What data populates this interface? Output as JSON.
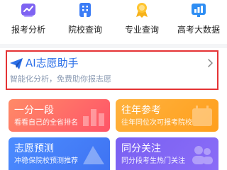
{
  "colors": {
    "assistant_border": "#e53335",
    "assistant_title": "#2b6fe8",
    "card_1": "#ff6a68",
    "card_2": "#ffa92f",
    "card_3": "#4680f8",
    "card_4": "#8066f4"
  },
  "nav": [
    {
      "label": "报考分析",
      "icon": "chart-analysis-icon"
    },
    {
      "label": "院校查询",
      "icon": "building-icon"
    },
    {
      "label": "专业查询",
      "icon": "award-ribbon-icon"
    },
    {
      "label": "高考大数据",
      "icon": "bar-chart-icon"
    }
  ],
  "assistant": {
    "icon": "paper-plane-icon",
    "title": "AI志愿助手",
    "subtitle": "智能化分析，免费助你报志愿",
    "chevron_icon": "chevron-right-icon"
  },
  "cards": [
    {
      "title": "一分一段",
      "subtitle": "看看自己的全省排名"
    },
    {
      "title": "往年参考",
      "subtitle": "往年同位次可报考院校"
    },
    {
      "title": "志愿预测",
      "subtitle": "冲稳保院校预测推荐"
    },
    {
      "title": "同分关注",
      "subtitle": "同分段考生热门关注"
    }
  ]
}
